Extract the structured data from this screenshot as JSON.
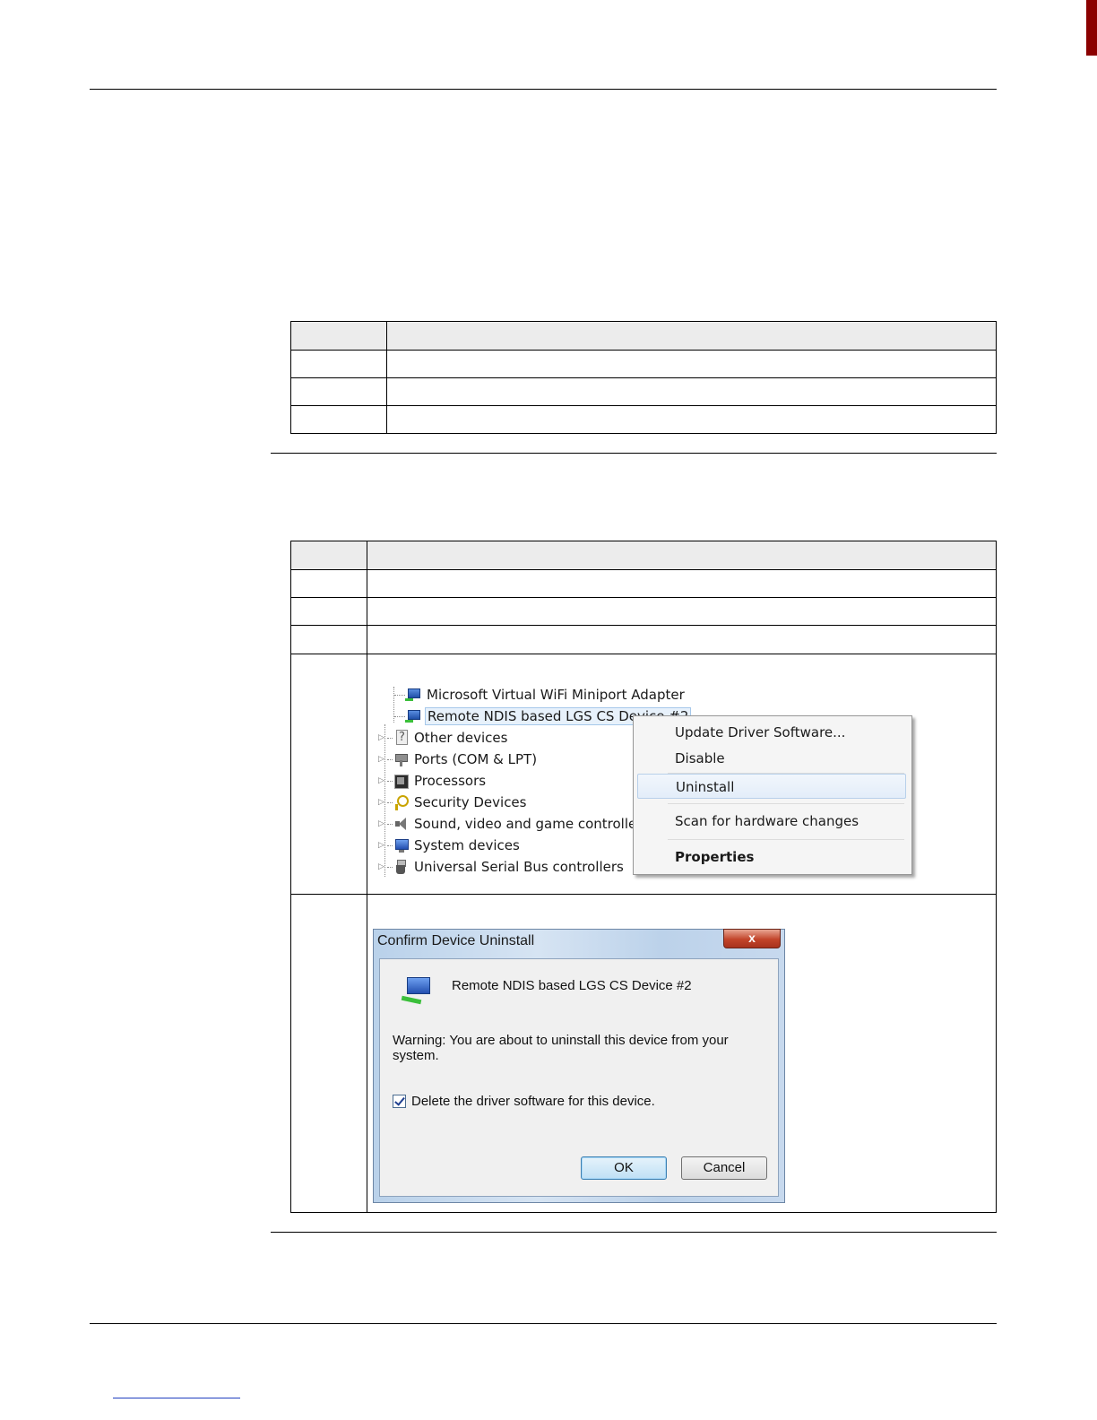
{
  "section1": {
    "table": {
      "rows": 4
    }
  },
  "section2": {
    "table": {
      "rows": 6
    },
    "device_manager": {
      "tree": [
        {
          "label": "Microsoft Virtual WiFi Miniport Adapter",
          "icon": "network-adapter-icon",
          "child": true
        },
        {
          "label": "Remote NDIS based LGS CS Device #2",
          "icon": "network-adapter-icon",
          "child": true,
          "selected": true
        },
        {
          "label": "Other devices",
          "icon": "unknown-device-icon"
        },
        {
          "label": "Ports (COM & LPT)",
          "icon": "port-icon"
        },
        {
          "label": "Processors",
          "icon": "processor-icon"
        },
        {
          "label": "Security Devices",
          "icon": "key-icon"
        },
        {
          "label": "Sound, video and game controllers",
          "icon": "speaker-icon"
        },
        {
          "label": "System devices",
          "icon": "computer-icon"
        },
        {
          "label": "Universal Serial Bus controllers",
          "icon": "usb-icon"
        }
      ],
      "context_menu": {
        "update_driver": "Update Driver Software...",
        "disable": "Disable",
        "uninstall": "Uninstall",
        "scan": "Scan for hardware changes",
        "properties": "Properties"
      }
    },
    "confirm_dialog": {
      "title": "Confirm Device Uninstall",
      "close_glyph": "x",
      "device_name": "Remote NDIS based LGS CS Device #2",
      "warning": "Warning: You are about to uninstall this device from your system.",
      "checkbox_label": "Delete the driver software for this device.",
      "checkbox_checked": true,
      "ok_label": "OK",
      "cancel_label": "Cancel"
    }
  }
}
